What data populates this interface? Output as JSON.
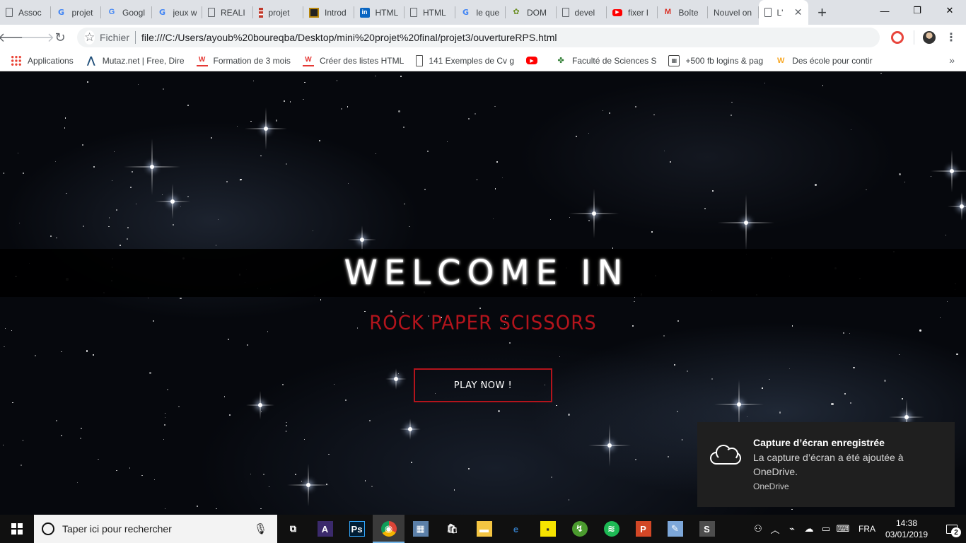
{
  "browser": {
    "tabs": [
      {
        "label": "Assoc",
        "icon": "doc"
      },
      {
        "label": "projet",
        "icon": "google"
      },
      {
        "label": "Googl",
        "icon": "google-translate"
      },
      {
        "label": "jeux w",
        "icon": "google"
      },
      {
        "label": "REALI",
        "icon": "doc-blue"
      },
      {
        "label": "projet",
        "icon": "stack"
      },
      {
        "label": "Introd",
        "icon": "framed"
      },
      {
        "label": "HTML",
        "icon": "linkedin"
      },
      {
        "label": "HTML",
        "icon": "doc"
      },
      {
        "label": "le que",
        "icon": "google"
      },
      {
        "label": "DOM",
        "icon": "dom"
      },
      {
        "label": "devel",
        "icon": "doc"
      },
      {
        "label": "fixer l",
        "icon": "youtube"
      },
      {
        "label": "Boîte",
        "icon": "gmail"
      },
      {
        "label": "Nouvel on",
        "icon": "none"
      },
      {
        "label": "L'",
        "icon": "doc",
        "active": true
      }
    ],
    "window_controls": {
      "minimize": "—",
      "maximize": "❐",
      "close": "✕"
    },
    "address": {
      "scheme_label": "Fichier",
      "url": "file:///C:/Users/ayoub%20boureqba/Desktop/mini%20projet%20final/projet3/ouvertureRPS.html"
    },
    "bookmarks": [
      {
        "label": "Applications",
        "icon": "apps-icon"
      },
      {
        "label": "Mutaz.net | Free, Dire",
        "icon": "mutaz-icon"
      },
      {
        "label": "Formation de 3 mois",
        "icon": "w-icon"
      },
      {
        "label": "Créer des listes HTML",
        "icon": "w-icon"
      },
      {
        "label": "141 Exemples de Cv g",
        "icon": "cv-icon"
      },
      {
        "label": "",
        "icon": "youtube-icon"
      },
      {
        "label": "Faculté de Sciences S",
        "icon": "fs-icon"
      },
      {
        "label": "+500 fb logins & pag",
        "icon": "fb-icon"
      },
      {
        "label": "Des école pour contir",
        "icon": "ec-icon"
      }
    ]
  },
  "page": {
    "welcome": "WELCOME IN",
    "subtitle": "ROCK PAPER SCISSORS",
    "play_button": "PLAY NOW !",
    "colors": {
      "accent": "#b3141c",
      "banner": "#000000"
    }
  },
  "toast": {
    "title": "Capture d’écran enregistrée",
    "body": "La capture d’écran a été ajoutée à OneDrive.",
    "source": "OneDrive"
  },
  "taskbar": {
    "search_placeholder": "Taper ici pour rechercher",
    "apps": [
      {
        "name": "task-view",
        "glyph": "⧉"
      },
      {
        "name": "avengers",
        "glyph": "A"
      },
      {
        "name": "photoshop",
        "glyph": "Ps"
      },
      {
        "name": "chrome",
        "glyph": "◉",
        "active": true
      },
      {
        "name": "file-manager",
        "glyph": "▦"
      },
      {
        "name": "store",
        "glyph": "🛍"
      },
      {
        "name": "explorer",
        "glyph": "▬"
      },
      {
        "name": "edge",
        "glyph": "e"
      },
      {
        "name": "sticky-notes",
        "glyph": "▪"
      },
      {
        "name": "bittorrent",
        "glyph": "↯"
      },
      {
        "name": "spotify",
        "glyph": "≋"
      },
      {
        "name": "powerpoint",
        "glyph": "P"
      },
      {
        "name": "paint",
        "glyph": "✎"
      },
      {
        "name": "sublime-text",
        "glyph": "S"
      }
    ],
    "language": "FRA",
    "time": "14:38",
    "date": "03/01/2019",
    "notifications": "2"
  }
}
